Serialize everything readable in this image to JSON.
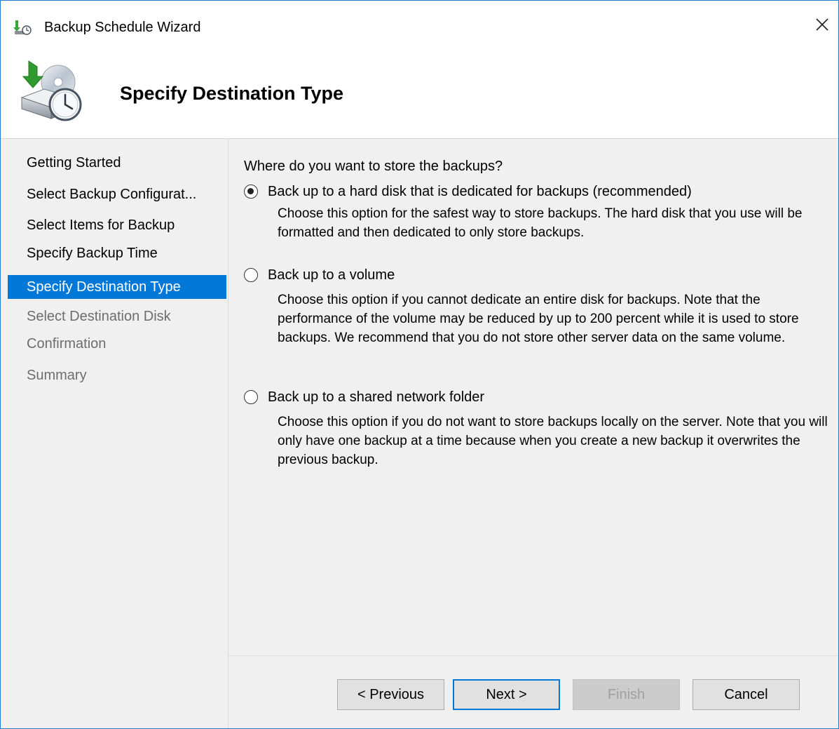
{
  "window": {
    "title": "Backup Schedule Wizard",
    "title_icon": "backup-wizard-icon",
    "close_icon": "close-icon"
  },
  "header": {
    "title": "Specify Destination Type",
    "icon": "backup-disk-clock-icon"
  },
  "sidebar": {
    "items": [
      {
        "label": "Getting Started",
        "state": "normal"
      },
      {
        "label": "Select Backup Configurat...",
        "state": "normal"
      },
      {
        "label": "Select Items for Backup",
        "state": "normal"
      },
      {
        "label": "Specify Backup Time",
        "state": "normal"
      },
      {
        "label": "Specify Destination Type",
        "state": "active"
      },
      {
        "label": "Select Destination Disk",
        "state": "disabled"
      },
      {
        "label": "Confirmation",
        "state": "disabled"
      },
      {
        "label": "Summary",
        "state": "disabled"
      }
    ]
  },
  "main": {
    "question": "Where do you want to store the backups?",
    "options": [
      {
        "label": "Back up to a hard disk that is dedicated for backups (recommended)",
        "description": "Choose this option for the safest way to store backups. The hard disk that you use will be formatted and then dedicated to only store backups.",
        "selected": true
      },
      {
        "label": "Back up to a volume",
        "description": "Choose this option if you cannot dedicate an entire disk for backups. Note that the performance of the volume may be reduced by up to 200 percent while it is used to store backups. We recommend that you do not store other server data on the same volume.",
        "selected": false
      },
      {
        "label": "Back up to a shared network folder",
        "description": "Choose this option if you do not want to store backups locally on the server. Note that you will only have one backup at a time because when you create a new backup it overwrites the previous backup.",
        "selected": false
      }
    ]
  },
  "buttons": {
    "previous": "< Previous",
    "next": "Next >",
    "finish": "Finish",
    "cancel": "Cancel"
  },
  "colors": {
    "accent": "#0078d7",
    "window_border": "#1e7fd1",
    "panel_bg": "#f0f0f0"
  }
}
